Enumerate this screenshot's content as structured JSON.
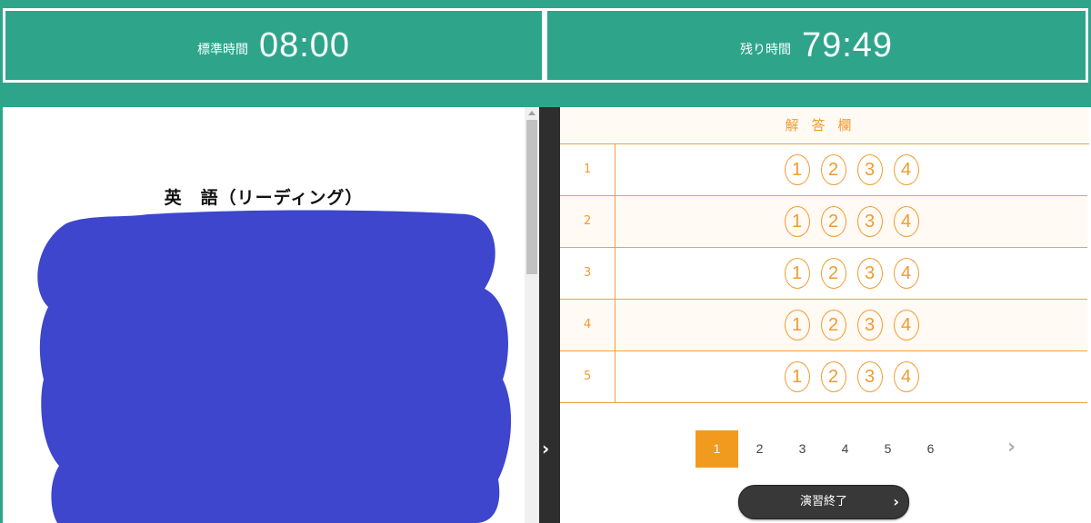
{
  "timers": {
    "standard": {
      "label": "標準時間",
      "value": "08:00"
    },
    "remaining": {
      "label": "残り時間",
      "value": "79:49"
    }
  },
  "document": {
    "title": "英　語（リーディング）"
  },
  "answer_sheet": {
    "header": "解答欄",
    "rows": [
      {
        "number": "1",
        "choices": [
          "1",
          "2",
          "3",
          "4"
        ]
      },
      {
        "number": "2",
        "choices": [
          "1",
          "2",
          "3",
          "4"
        ]
      },
      {
        "number": "3",
        "choices": [
          "1",
          "2",
          "3",
          "4"
        ]
      },
      {
        "number": "4",
        "choices": [
          "1",
          "2",
          "3",
          "4"
        ]
      },
      {
        "number": "5",
        "choices": [
          "1",
          "2",
          "3",
          "4"
        ]
      }
    ]
  },
  "pagination": {
    "pages": [
      "1",
      "2",
      "3",
      "4",
      "5",
      "6"
    ],
    "current": "1",
    "next_icon": "chevron-right-icon"
  },
  "finish_button": {
    "label": "演習終了",
    "icon": "chevron-right-icon"
  },
  "splitter": {
    "icon": "chevron-right-icon"
  },
  "colors": {
    "accent_green": "#2ea58b",
    "answer_orange": "#f29a30",
    "active_page": "#f29a1e",
    "redaction_blue": "#3d46cc"
  }
}
